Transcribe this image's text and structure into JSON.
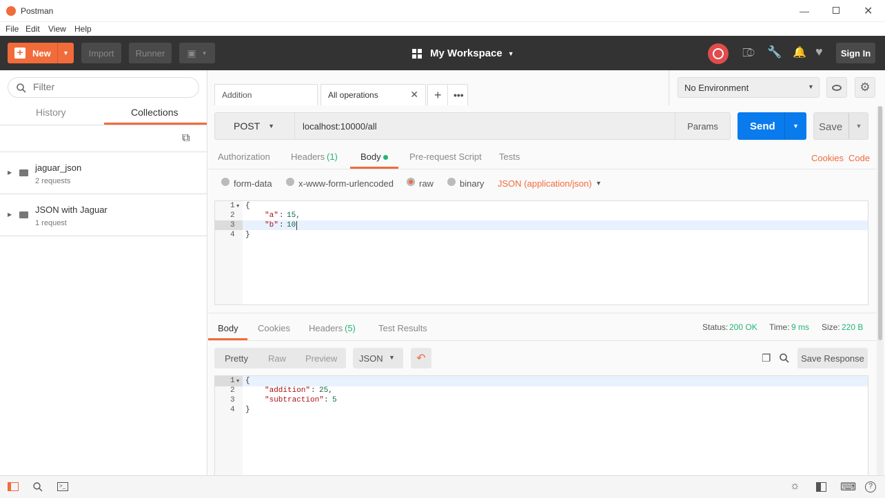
{
  "window": {
    "title": "Postman"
  },
  "menu": [
    "File",
    "Edit",
    "View",
    "Help"
  ],
  "toolbar": {
    "new_label": "New",
    "import_label": "Import",
    "runner_label": "Runner",
    "workspace_label": "My Workspace",
    "sign_in_label": "Sign In"
  },
  "sidebar": {
    "filter_placeholder": "Filter",
    "tabs": [
      "History",
      "Collections"
    ],
    "active_tab": "Collections",
    "collections": [
      {
        "name": "jaguar_json",
        "count": "2 requests"
      },
      {
        "name": "JSON with Jaguar",
        "count": "1 request"
      }
    ]
  },
  "request_tabs": [
    "Addition",
    "All operations"
  ],
  "environment": {
    "selected": "No Environment"
  },
  "request": {
    "method": "POST",
    "url": "localhost:10000/all",
    "params_label": "Params",
    "send_label": "Send",
    "save_label": "Save",
    "subtabs": [
      "Authorization",
      "Headers",
      "(1)",
      "Body",
      "Pre-request Script",
      "Tests"
    ],
    "cookies_label": "Cookies",
    "code_label": "Code",
    "body_modes": [
      "form-data",
      "x-www-form-urlencoded",
      "raw",
      "binary"
    ],
    "selected_mode": "raw",
    "content_type": "JSON (application/json)",
    "body_lines": [
      {
        "num": "1",
        "text": "{"
      },
      {
        "num": "2",
        "key": "\"a\"",
        "val": "15,"
      },
      {
        "num": "3",
        "key": "\"b\"",
        "val": "10"
      },
      {
        "num": "4",
        "text": "}"
      }
    ]
  },
  "response": {
    "tabs": [
      "Body",
      "Cookies",
      "Headers",
      "(5)",
      "Test Results"
    ],
    "status_label": "Status:",
    "status_value": "200 OK",
    "time_label": "Time:",
    "time_value": "9 ms",
    "size_label": "Size:",
    "size_value": "220 B",
    "view_modes": [
      "Pretty",
      "Raw",
      "Preview"
    ],
    "format": "JSON",
    "save_response_label": "Save Response",
    "body_lines": [
      {
        "num": "1",
        "text": "{"
      },
      {
        "num": "2",
        "key": "\"addition\"",
        "val": "25,"
      },
      {
        "num": "3",
        "key": "\"subtraction\"",
        "val": "5"
      },
      {
        "num": "4",
        "text": "}"
      }
    ]
  },
  "colors": {
    "accent": "#f26b3a",
    "send": "#097bed",
    "status_ok": "#22b573",
    "toolbar_bg": "#333333"
  }
}
